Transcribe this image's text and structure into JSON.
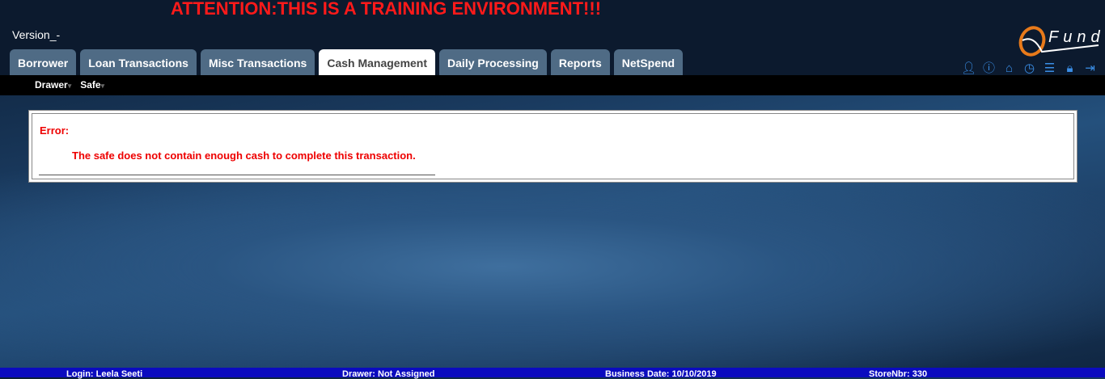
{
  "banner": "ATTENTION:THIS IS A TRAINING ENVIRONMENT!!!",
  "version": "Version_-",
  "logo_text": "Fund",
  "tabs": [
    {
      "label": "Borrower"
    },
    {
      "label": "Loan Transactions"
    },
    {
      "label": "Misc Transactions"
    },
    {
      "label": "Cash Management"
    },
    {
      "label": "Daily Processing"
    },
    {
      "label": "Reports"
    },
    {
      "label": "NetSpend"
    }
  ],
  "active_tab": "Cash Management",
  "icons": [
    "user-icon",
    "info-icon",
    "home-icon",
    "clock-icon",
    "list-icon",
    "lock-icon",
    "logout-icon"
  ],
  "subnav": [
    {
      "label": "Drawer"
    },
    {
      "label": "Safe"
    }
  ],
  "error": {
    "title": "Error:",
    "message": "The safe does not contain enough cash to complete this transaction."
  },
  "footer": {
    "login": "Login: Leela Seeti",
    "drawer": "Drawer: Not Assigned",
    "business_date": "Business Date: 10/10/2019",
    "store": "StoreNbr: 330"
  }
}
